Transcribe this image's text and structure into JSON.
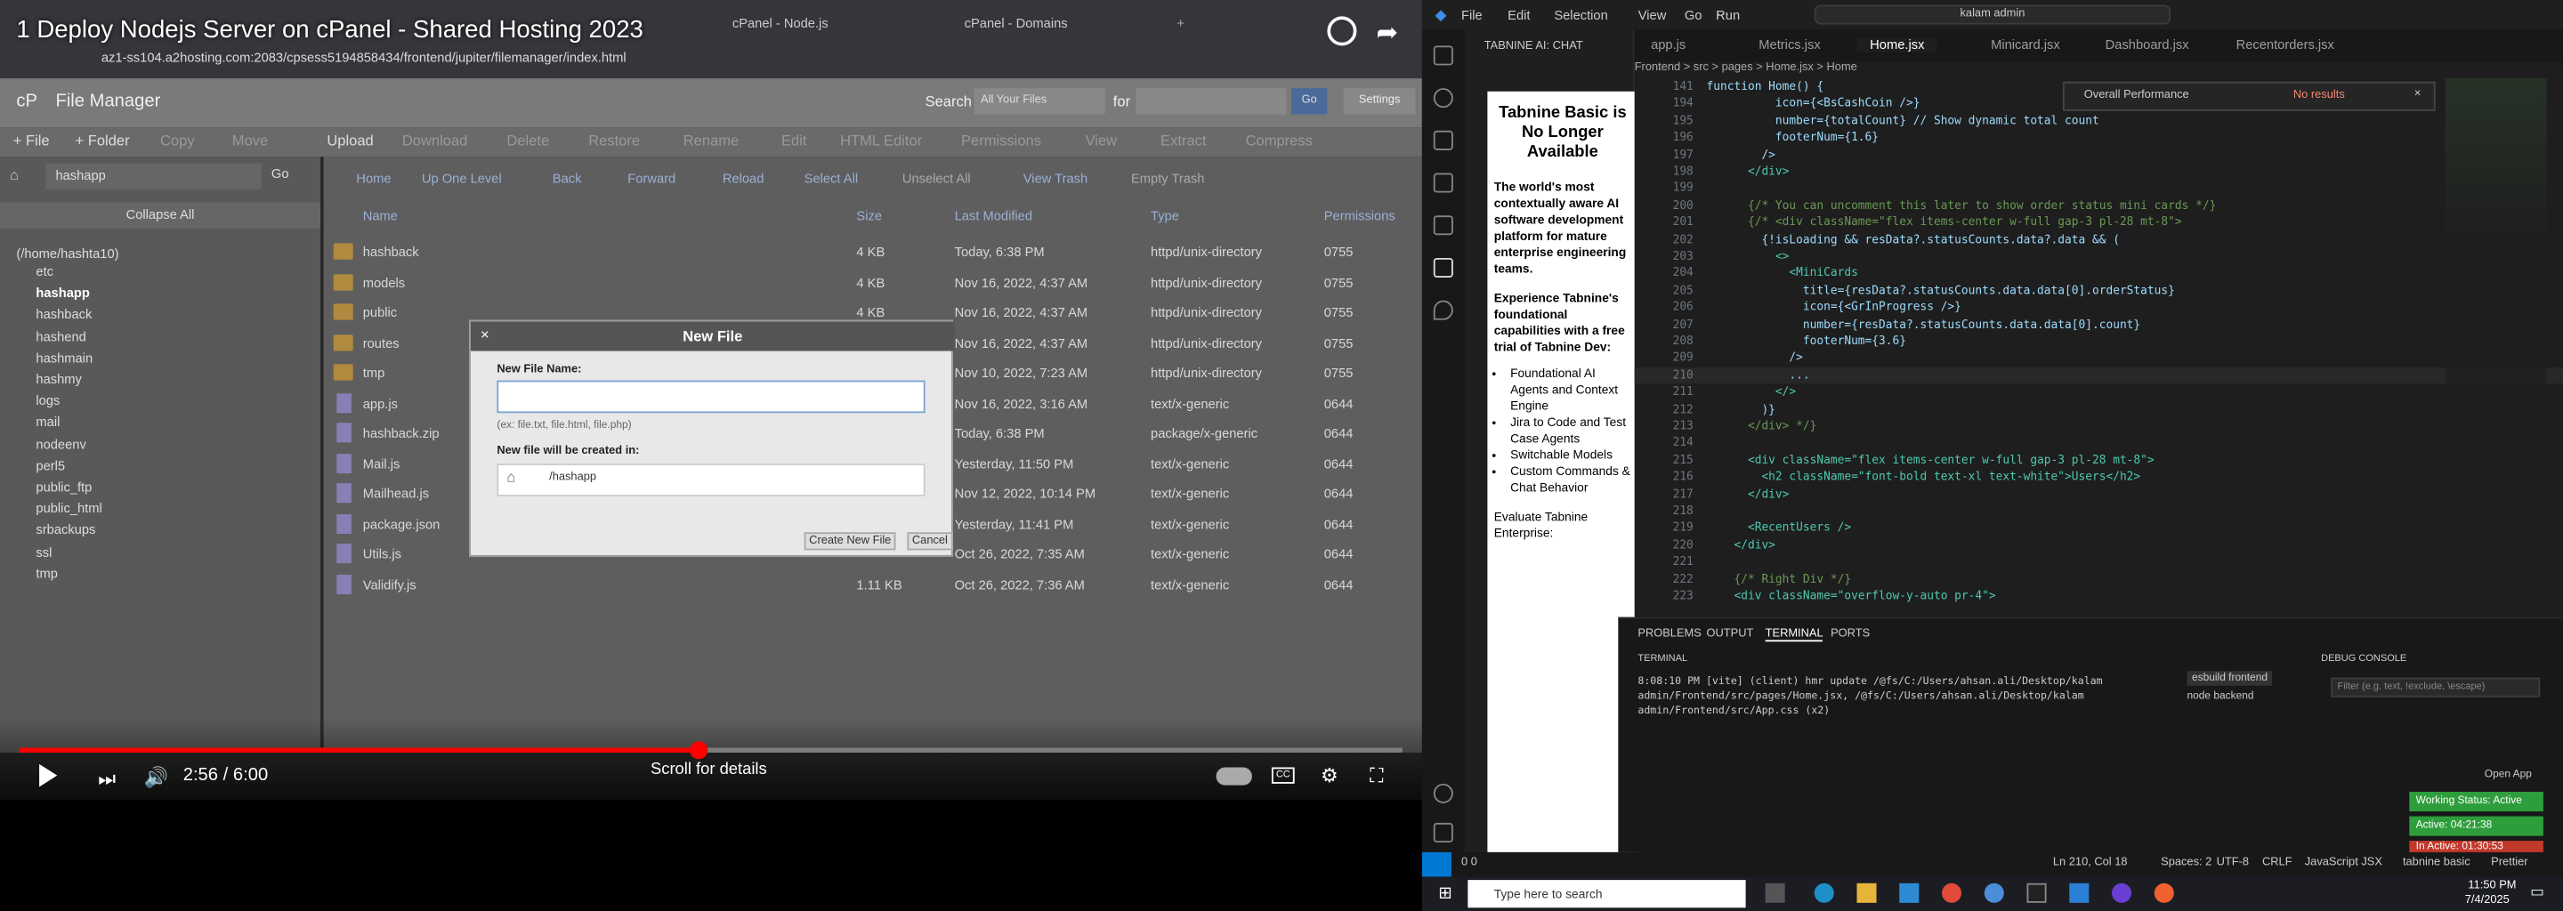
{
  "video": {
    "title": "1 Deploy Nodejs Server on cPanel - Shared Hosting 2023",
    "time": "2:56 / 6:00",
    "scroll_hint": "Scroll for details",
    "progress": 0.49,
    "browser": {
      "tabs": [
        "cPanel - Node.js",
        "cPanel - Domains"
      ],
      "url": "az1-ss104.a2hosting.com:2083/cpsess5194858434/frontend/jupiter/filemanager/index.html"
    },
    "cpanel": {
      "title": "File Manager",
      "search_label": "Search",
      "search_scope": "All Your Files",
      "for_label": "for",
      "go": "Go",
      "settings": "Settings",
      "toolbar": [
        "+ File",
        "+ Folder",
        "Copy",
        "Move",
        "Upload",
        "Download",
        "Delete",
        "Restore",
        "Rename",
        "Edit",
        "HTML Editor",
        "Permissions",
        "View",
        "Extract",
        "Compress"
      ],
      "path_input": "hashapp",
      "collapse_all": "Collapse All",
      "nav": [
        "Home",
        "Up One Level",
        "Back",
        "Forward",
        "Reload",
        "Select All",
        "Unselect All",
        "View Trash",
        "Empty Trash"
      ],
      "tree_root": "(/home/hashta10)",
      "tree": [
        "etc",
        "hashapp",
        "hashback",
        "hashend",
        "hashmain",
        "hashmy",
        "logs",
        "mail",
        "nodeenv",
        "perl5",
        "public_ftp",
        "public_html",
        "srbackups",
        "ssl",
        "tmp"
      ],
      "columns": [
        "Name",
        "Size",
        "Last Modified",
        "Type",
        "Permissions"
      ],
      "files": [
        {
          "name": "hashback",
          "size": "4 KB",
          "modified": "Today, 6:38 PM",
          "type": "httpd/unix-directory",
          "perm": "0755",
          "kind": "folder"
        },
        {
          "name": "models",
          "size": "4 KB",
          "modified": "Nov 16, 2022, 4:37 AM",
          "type": "httpd/unix-directory",
          "perm": "0755",
          "kind": "folder"
        },
        {
          "name": "public",
          "size": "4 KB",
          "modified": "Nov 16, 2022, 4:37 AM",
          "type": "httpd/unix-directory",
          "perm": "0755",
          "kind": "folder"
        },
        {
          "name": "routes",
          "size": "4 KB",
          "modified": "Nov 16, 2022, 4:37 AM",
          "type": "httpd/unix-directory",
          "perm": "0755",
          "kind": "folder"
        },
        {
          "name": "tmp",
          "size": "4 KB",
          "modified": "Nov 10, 2022, 7:23 AM",
          "type": "httpd/unix-directory",
          "perm": "0755",
          "kind": "folder"
        },
        {
          "name": "app.js",
          "size": "",
          "modified": "Nov 16, 2022, 3:16 AM",
          "type": "text/x-generic",
          "perm": "0644",
          "kind": "file"
        },
        {
          "name": "hashback.zip",
          "size": "",
          "modified": "Today, 6:38 PM",
          "type": "package/x-generic",
          "perm": "0644",
          "kind": "file"
        },
        {
          "name": "Mail.js",
          "size": "",
          "modified": "Yesterday, 11:50 PM",
          "type": "text/x-generic",
          "perm": "0644",
          "kind": "file"
        },
        {
          "name": "Mailhead.js",
          "size": "",
          "modified": "Nov 12, 2022, 10:14 PM",
          "type": "text/x-generic",
          "perm": "0644",
          "kind": "file"
        },
        {
          "name": "package.json",
          "size": "",
          "modified": "Yesterday, 11:41 PM",
          "type": "text/x-generic",
          "perm": "0644",
          "kind": "file"
        },
        {
          "name": "Utils.js",
          "size": "",
          "modified": "Oct 26, 2022, 7:35 AM",
          "type": "text/x-generic",
          "perm": "0644",
          "kind": "file"
        },
        {
          "name": "Validify.js",
          "size": "1.11 KB",
          "modified": "Oct 26, 2022, 7:36 AM",
          "type": "text/x-generic",
          "perm": "0644",
          "kind": "file"
        }
      ],
      "dialog": {
        "title": "New File",
        "name_label": "New File Name:",
        "hint": "(ex: file.txt, file.html, file.php)",
        "dir_label": "New file will be created in:",
        "dir_value": "/hashapp",
        "create": "Create New File",
        "cancel": "Cancel"
      }
    }
  },
  "vscode": {
    "menu": [
      "File",
      "Edit",
      "Selection",
      "View",
      "Go",
      "Run"
    ],
    "search": "kalam admin",
    "chat_title": "TABNINE AI: CHAT",
    "chat": {
      "heading": "Tabnine Basic is No Longer Available",
      "p1": "The world's most contextually aware AI software development platform for mature enterprise engineering teams.",
      "p2": "Experience Tabnine's foundational capabilities with a free trial of Tabnine Dev:",
      "bullets": [
        "Foundational AI Agents and Context Engine",
        "Jira to Code and Test Case Agents",
        "Switchable Models",
        "Custom Commands & Chat Behavior"
      ],
      "p3": "Evaluate Tabnine Enterprise:"
    },
    "tabs": [
      "app.js",
      "Metrics.jsx",
      "Home.jsx",
      "Minicard.jsx",
      "Dashboard.jsx",
      "Recentorders.jsx"
    ],
    "breadcrumb": "Frontend > src > pages > Home.jsx > Home",
    "find": {
      "query": "Overall Performance",
      "result": "No results"
    },
    "code": [
      [
        "141",
        "function Home() {"
      ],
      [
        "194",
        "          icon={<BsCashCoin />}"
      ],
      [
        "195",
        "          number={totalCount} // Show dynamic total count"
      ],
      [
        "196",
        "          footerNum={1.6}"
      ],
      [
        "197",
        "        />"
      ],
      [
        "198",
        "      </div>"
      ],
      [
        "199",
        ""
      ],
      [
        "200",
        "      {/* You can uncomment this later to show order status mini cards */}"
      ],
      [
        "201",
        "      {/* <div className=\"flex items-center w-full gap-3 pl-28 mt-8\">"
      ],
      [
        "202",
        "        {!isLoading && resData?.statusCounts.data?.data && ("
      ],
      [
        "203",
        "          <>"
      ],
      [
        "204",
        "            <MiniCards"
      ],
      [
        "205",
        "              title={resData?.statusCounts.data.data[0].orderStatus}"
      ],
      [
        "206",
        "              icon={<GrInProgress />}"
      ],
      [
        "207",
        "              number={resData?.statusCounts.data.data[0].count}"
      ],
      [
        "208",
        "              footerNum={3.6}"
      ],
      [
        "209",
        "            />"
      ],
      [
        "210",
        "            ..."
      ],
      [
        "211",
        "          </>"
      ],
      [
        "212",
        "        )}"
      ],
      [
        "213",
        "      </div> */}"
      ],
      [
        "214",
        ""
      ],
      [
        "215",
        "      <div className=\"flex items-center w-full gap-3 pl-28 mt-8\">"
      ],
      [
        "216",
        "        <h2 className=\"font-bold text-xl text-white\">Users</h2>"
      ],
      [
        "217",
        "      </div>"
      ],
      [
        "218",
        ""
      ],
      [
        "219",
        "      <RecentUsers />"
      ],
      [
        "220",
        "    </div>"
      ],
      [
        "221",
        ""
      ],
      [
        "222",
        "    {/* Right Div */}"
      ],
      [
        "223",
        "    <div className=\"overflow-y-auto pr-4\">"
      ]
    ],
    "panel_tabs": [
      "PROBLEMS",
      "OUTPUT",
      "TERMINAL",
      "PORTS"
    ],
    "terminal_label": "TERMINAL",
    "terminal_text": "8:08:10 PM [vite] (client) hmr update /@fs/C:/Users/ahsan.ali/Desktop/kalam admin/Frontend/src/pages/Home.jsx, /@fs/C:/Users/ahsan.ali/Desktop/kalam admin/Frontend/src/App.css (x2)",
    "terminals": [
      "esbuild frontend",
      "node backend"
    ],
    "debug_console": "DEBUG CONSOLE",
    "debug_filter": "Filter (e.g. text, !exclude, \\escape)",
    "open_app": "Open App",
    "working_status": "Working Status: Active",
    "active_time": "Active: 04:21:38",
    "inactive_time": "In Active: 01:30:53",
    "status": {
      "problems": "0  0",
      "position": "Ln 210, Col 18",
      "spaces": "Spaces: 2",
      "encoding": "UTF-8",
      "eol": "CRLF",
      "lang": "JavaScript JSX",
      "tabnine": "tabnine basic",
      "prettier": "Prettier"
    }
  },
  "taskbar": {
    "search": "Type here to search",
    "time": "11:50 PM",
    "date": "7/4/2025"
  }
}
